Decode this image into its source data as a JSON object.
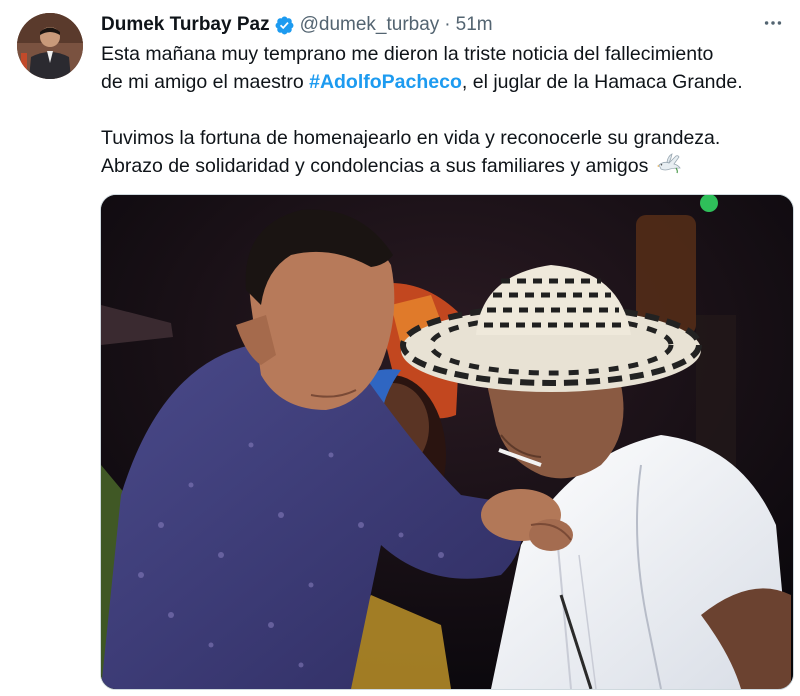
{
  "author": {
    "display_name": "Dumek Turbay Paz",
    "handle": "@dumek_turbay",
    "separator": "·",
    "timestamp": "51m",
    "verified": true,
    "verified_color": "#1d9bf0"
  },
  "tweet": {
    "line1": "Esta mañana muy temprano me dieron la triste noticia del fallecimiento",
    "line2_prefix": "de mi amigo el maestro ",
    "hashtag": "#AdolfoPacheco",
    "line2_suffix": ", el juglar de la Hamaca Grande.",
    "line3": "Tuvimos la fortuna de homenajearlo en vida y reconocerle su grandeza.",
    "line4": "Abrazo de solidaridad y condolencias a sus familiares y amigos",
    "emoji": "dove-icon"
  },
  "colors": {
    "text": "#0f1419",
    "secondary": "#536471",
    "link": "#1d9bf0"
  },
  "icons": {
    "more": "more-horizontal-icon",
    "verified": "verified-badge-icon"
  }
}
